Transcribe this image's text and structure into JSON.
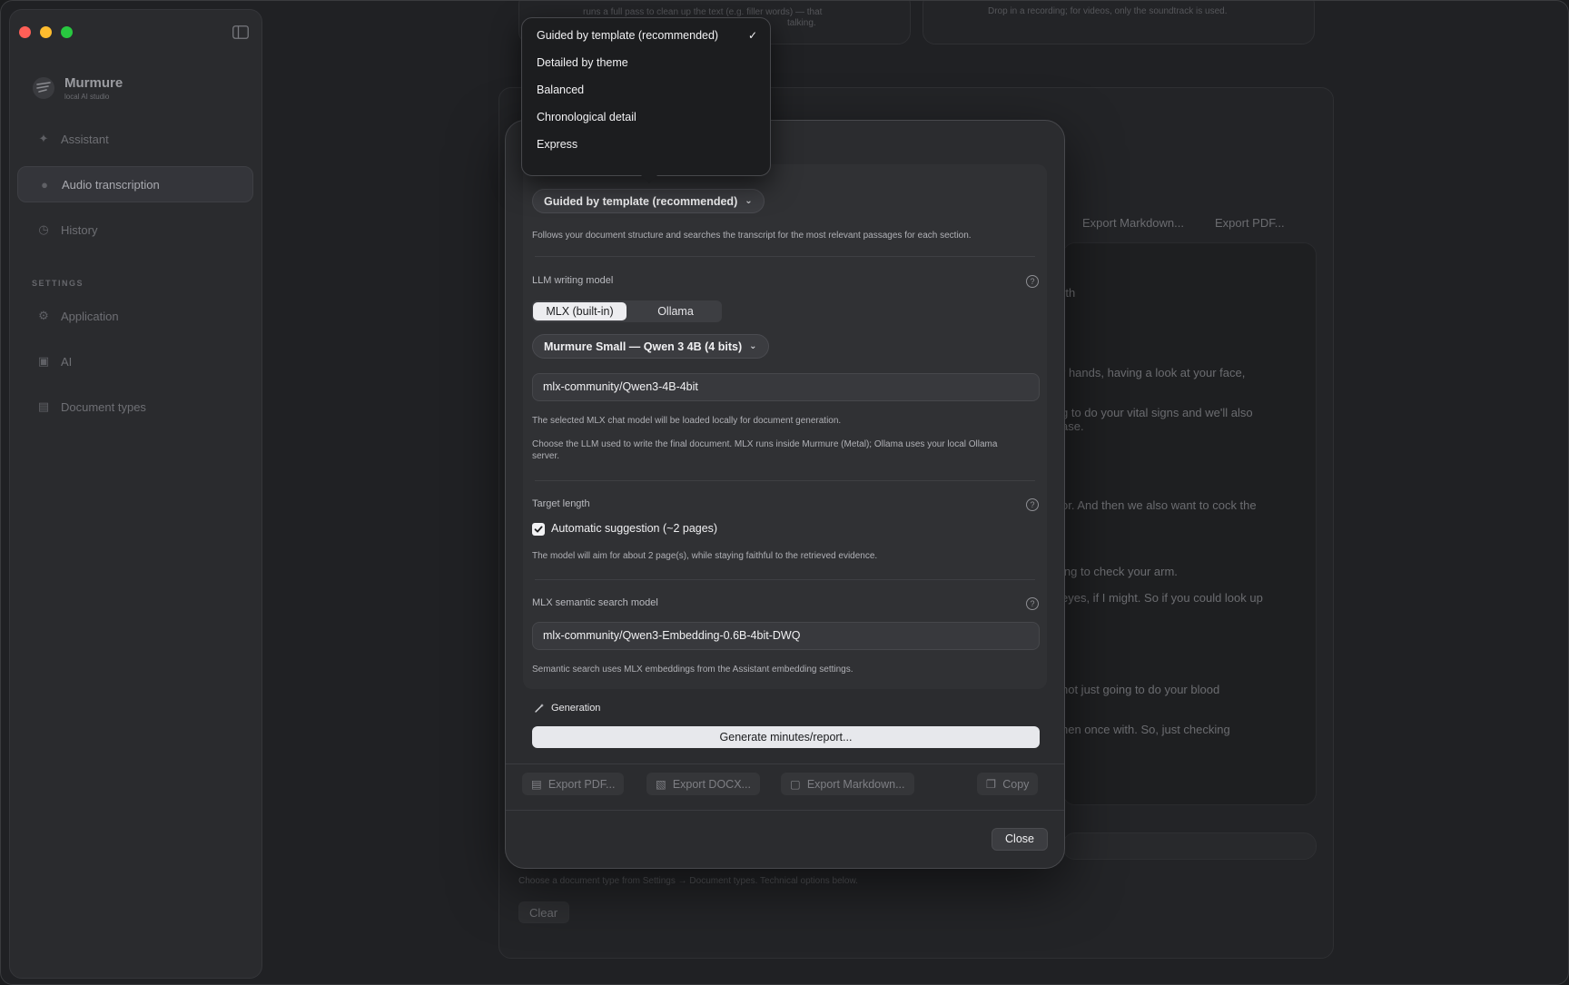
{
  "sidebar": {
    "brand_name": "Murmure",
    "brand_tagline": "local AI studio",
    "items": [
      {
        "label": "Assistant"
      },
      {
        "label": "Audio transcription"
      },
      {
        "label": "History"
      }
    ],
    "settings_heading": "SETTINGS",
    "settings_items": [
      {
        "label": "Application"
      },
      {
        "label": "AI"
      },
      {
        "label": "Document types"
      }
    ]
  },
  "background": {
    "top_card_left_line1": "runs a full pass to clean up the text (e.g. filler words) — that",
    "top_card_left_line2": "talking.",
    "top_card_right": "Drop in a recording; for videos, only the soundtrack is used.",
    "export_markdown": "Export Markdown...",
    "export_pdf": "Export PDF...",
    "transcript_fragments": [
      "rth",
      "r hands, having a look at your face,",
      "g to do your vital signs and we'll also",
      "ase.",
      "or. And then we also want to cock the",
      "ing to check your arm.",
      "eyes, if I might. So if you could look up",
      "not just going to do your blood",
      "hen once with. So, just checking"
    ],
    "hint": "Choose a document type from Settings → Document types. Technical options below.",
    "clear_button": "Clear"
  },
  "dropdown": {
    "options": [
      "Guided by template (recommended)",
      "Detailed by theme",
      "Balanced",
      "Chronological detail",
      "Express"
    ],
    "check_glyph": "✓"
  },
  "modal": {
    "strategy_select": "Guided by template (recommended)",
    "strategy_desc": "Follows your document structure and searches the transcript for the most relevant passages for each section.",
    "llm_label": "LLM writing model",
    "engine_options": [
      "MLX (built-in)",
      "Ollama"
    ],
    "model_select": "Murmure Small — Qwen 3 4B (4 bits)",
    "model_id": "mlx-community/Qwen3-4B-4bit",
    "model_note": "The selected MLX chat model will be loaded locally for document generation.",
    "llm_desc": "Choose the LLM used to write the final document. MLX runs inside Murmure (Metal); Ollama uses your local Ollama server.",
    "target_label": "Target length",
    "auto_suggest": "Automatic suggestion (~2 pages)",
    "target_desc": "The model will aim for about 2 page(s), while staying faithful to the retrieved evidence.",
    "search_label": "MLX semantic search model",
    "search_model": "mlx-community/Qwen3-Embedding-0.6B-4bit-DWQ",
    "search_desc": "Semantic search uses MLX embeddings from the Assistant embedding settings.",
    "generation_label": "Generation",
    "generate_button": "Generate minutes/report...",
    "export_pdf": "Export PDF...",
    "export_docx": "Export DOCX...",
    "export_markdown": "Export Markdown...",
    "copy": "Copy",
    "close": "Close",
    "help_glyph": "?"
  }
}
